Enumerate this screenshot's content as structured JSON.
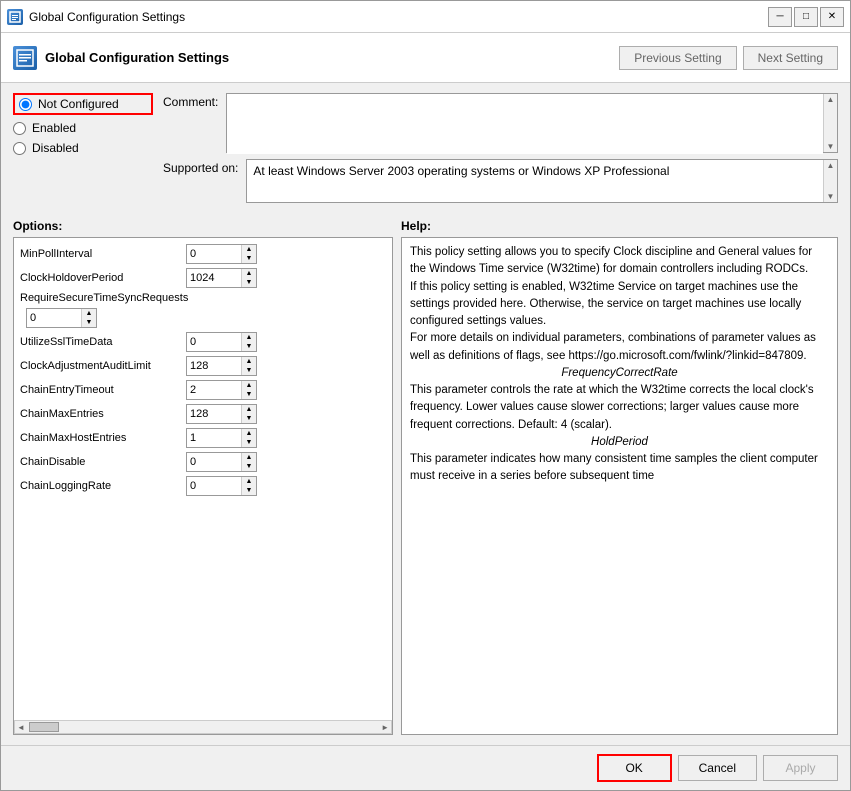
{
  "window": {
    "title": "Global Configuration Settings",
    "minimize_label": "─",
    "maximize_label": "□",
    "close_label": "✕"
  },
  "header": {
    "title": "Global Configuration Settings",
    "prev_btn": "Previous Setting",
    "next_btn": "Next Setting"
  },
  "radio": {
    "not_configured_label": "Not Configured",
    "enabled_label": "Enabled",
    "disabled_label": "Disabled"
  },
  "comment": {
    "label": "Comment:",
    "value": ""
  },
  "supported": {
    "label": "Supported on:",
    "value": "At least Windows Server 2003 operating systems or Windows XP Professional"
  },
  "options": {
    "header": "Options:",
    "items": [
      {
        "label": "MinPollInterval",
        "value": "0"
      },
      {
        "label": "ClockHoldoverPeriod",
        "value": "1024"
      },
      {
        "label": "RequireSecureTimeSyncRequests",
        "value": ""
      },
      {
        "label": "0",
        "value": "0",
        "type": "spinner"
      },
      {
        "label": "UtilizeSslTimeData",
        "value": "0"
      },
      {
        "label": "ClockAdjustmentAuditLimit",
        "value": "128"
      },
      {
        "label": "ChainEntryTimeout",
        "value": "2"
      },
      {
        "label": "ChainMaxEntries",
        "value": "128"
      },
      {
        "label": "ChainMaxHostEntries",
        "value": "1"
      },
      {
        "label": "ChainDisable",
        "value": "0"
      },
      {
        "label": "ChainLoggingRate",
        "value": "0"
      }
    ]
  },
  "help": {
    "header": "Help:",
    "paragraphs": [
      "This policy setting allows you to specify Clock discipline and General values for the Windows Time service (W32time) for domain controllers including RODCs.",
      "If this policy setting is enabled, W32time Service on target machines use the settings provided here. Otherwise, the service on target machines use locally configured settings values.",
      "For more details on individual parameters, combinations of parameter values as well as definitions of flags, see https://go.microsoft.com/fwlink/?linkid=847809.",
      "FrequencyCorrectRate",
      "This parameter controls the rate at which the W32time corrects the local clock's frequency. Lower values cause slower corrections; larger values cause more frequent corrections. Default: 4 (scalar).",
      "HoldPeriod",
      "This parameter indicates how many consistent time samples the client computer must receive in a series before subsequent time"
    ]
  },
  "footer": {
    "ok_label": "OK",
    "cancel_label": "Cancel",
    "apply_label": "Apply"
  }
}
